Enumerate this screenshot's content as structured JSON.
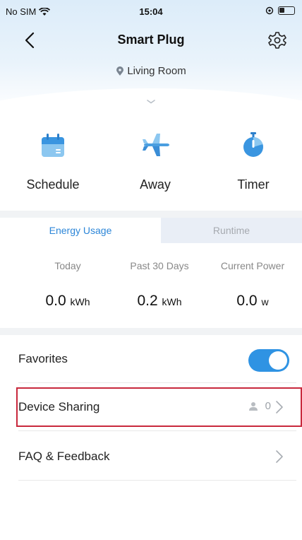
{
  "status_bar": {
    "carrier": "No SIM",
    "time": "15:04"
  },
  "header": {
    "title": "Smart Plug",
    "location": "Living Room",
    "icons": {
      "back": "chevron-left-icon",
      "settings": "gear-icon",
      "location": "location-pin-icon",
      "expand": "chevron-down-icon"
    }
  },
  "modes": [
    {
      "label": "Schedule",
      "icon": "calendar-icon"
    },
    {
      "label": "Away",
      "icon": "airplane-icon"
    },
    {
      "label": "Timer",
      "icon": "stopwatch-icon"
    }
  ],
  "energy": {
    "tabs": [
      {
        "label": "Energy Usage",
        "active": true
      },
      {
        "label": "Runtime",
        "active": false
      }
    ],
    "stats": [
      {
        "label": "Today",
        "value": "0.0",
        "unit": "kWh"
      },
      {
        "label": "Past 30 Days",
        "value": "0.2",
        "unit": "kWh"
      },
      {
        "label": "Current Power",
        "value": "0.0",
        "unit": "w"
      }
    ]
  },
  "settings_list": {
    "favorites": {
      "label": "Favorites",
      "enabled": true
    },
    "device_sharing": {
      "label": "Device Sharing",
      "count": "0"
    },
    "faq": {
      "label": "FAQ & Feedback"
    }
  },
  "colors": {
    "accent": "#2c86d8",
    "toggle": "#2f93e3",
    "highlight": "#c8283c",
    "icon_blue": "#4a9ee0"
  }
}
